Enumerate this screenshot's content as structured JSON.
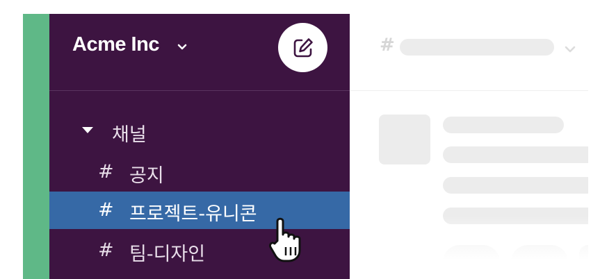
{
  "workspace": {
    "name": "Acme Inc",
    "chevron_icon": "chevron-down-icon",
    "compose_icon": "compose-icon"
  },
  "sidebar": {
    "section": {
      "label": "채널",
      "icon": "caret-down-icon"
    },
    "channels": [
      {
        "prefix": "#",
        "label": "공지",
        "active": false
      },
      {
        "prefix": "#",
        "label": "프로젝트-유니콘",
        "active": true
      },
      {
        "prefix": "#",
        "label": "팀-디자인",
        "active": false
      }
    ]
  },
  "main": {
    "channel_prefix": "#"
  },
  "colors": {
    "sidebar": "#3d1441",
    "accent_strip": "#5fb887",
    "active_item": "#3669a6",
    "placeholder": "#ececec"
  },
  "cursor": "hand-pointer-icon"
}
